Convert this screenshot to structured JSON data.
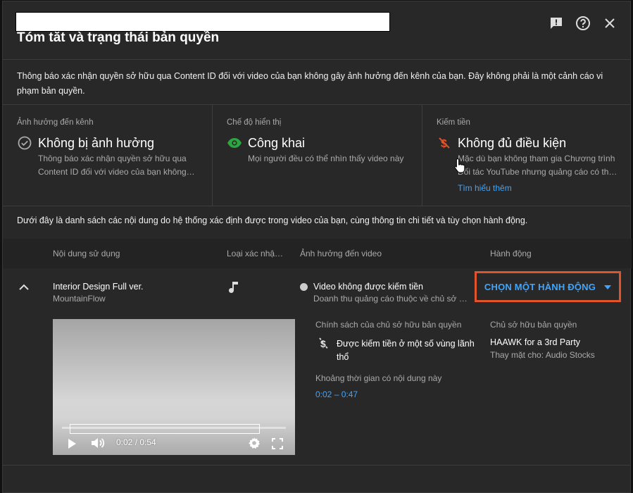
{
  "header": {
    "title": "Tóm tắt và trạng thái bản quyền"
  },
  "notice": "Thông báo xác nhận quyền sở hữu qua Content ID đối với video của bạn không gây ảnh hưởng đến kênh của bạn. Đây không phải là một cảnh cáo vi phạm bản quyền.",
  "cards": [
    {
      "label": "Ảnh hưởng đến kênh",
      "status": "Không bị ảnh hưởng",
      "icon": "check-circle-icon",
      "desc": "Thông báo xác nhận quyền sở hữu qua\nContent ID đối với video của bạn không…"
    },
    {
      "label": "Chế độ hiển thị",
      "status": "Công khai",
      "icon": "eye-icon",
      "desc": "Mọi người đều có thể nhìn thấy video này"
    },
    {
      "label": "Kiếm tiền",
      "status": "Không đủ điều kiện",
      "icon": "no-money-icon",
      "desc": "Mặc dù bạn không tham gia Chương trình\nĐối tác YouTube nhưng quảng cáo có th…",
      "link": "Tìm hiểu thêm"
    }
  ],
  "list_intro": "Dưới đây là danh sách các nội dung do hệ thống xác định được trong video của bạn, cùng thông tin chi tiết và tùy chọn hành động.",
  "table": {
    "headers": [
      "Nội dung sử dụng",
      "Loại xác nhậ…",
      "Ảnh hưởng đến video",
      "Hành động"
    ],
    "row": {
      "title": "Interior Design Full ver.",
      "artist": "MountainFlow",
      "claim_type_icon": "music-note-icon",
      "impact_title": "Video không được kiếm tiền",
      "impact_sub": "Doanh thu quảng cáo thuộc về chủ sở hữ…",
      "action_label": "CHỌN MỘT HÀNH ĐỘNG"
    }
  },
  "details": {
    "policy_label": "Chính sách của chủ sở hữu bản quyền",
    "policy_text": "Được kiếm tiền ở một số vùng lãnh thổ",
    "range_label": "Khoảng thời gian có nội dung này",
    "range_value": "0:02 – 0:47",
    "owner_label": "Chủ sở hữu bản quyền",
    "owner_name": "HAAWK for a 3rd Party",
    "owner_on_behalf": "Thay mặt cho: Audio Stocks"
  },
  "player": {
    "time": "0:02 / 0:54"
  },
  "colors": {
    "accent": "#3ea6ff",
    "highlight": "#e0542c",
    "dialog_bg": "#282828"
  }
}
